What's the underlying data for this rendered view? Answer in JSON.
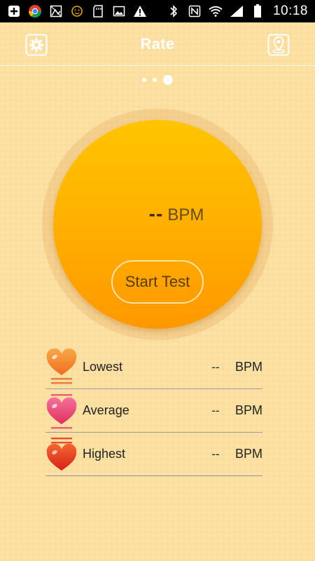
{
  "status_bar": {
    "time": "10:18",
    "left_icons": [
      "plus-box-icon",
      "chrome-icon",
      "image-broken-icon",
      "face-icon",
      "sd-card-icon",
      "photo-icon",
      "warning-icon"
    ],
    "right_icons": [
      "bluetooth-icon",
      "nfc-icon",
      "wifi-icon",
      "signal-icon",
      "battery-icon"
    ]
  },
  "header": {
    "title": "Rate",
    "left_icon": "settings-gear-icon",
    "right_icon": "location-pin-icon"
  },
  "pager": {
    "count": 3,
    "active_index": 2
  },
  "measurement": {
    "value": "--",
    "unit": "BPM",
    "start_button_label": "Start Test"
  },
  "stats": [
    {
      "label": "Lowest",
      "value": "--",
      "unit": "BPM",
      "icon": "heart-lowest-icon"
    },
    {
      "label": "Average",
      "value": "--",
      "unit": "BPM",
      "icon": "heart-average-icon"
    },
    {
      "label": "Highest",
      "value": "--",
      "unit": "BPM",
      "icon": "heart-highest-icon"
    }
  ],
  "colors": {
    "background": "#fbdfa0",
    "circle_top": "#ffc400",
    "circle_bottom": "#ff9800",
    "heart_lowest": "#f2862c",
    "heart_average": "#ea4f7a",
    "heart_highest": "#e8332a"
  }
}
